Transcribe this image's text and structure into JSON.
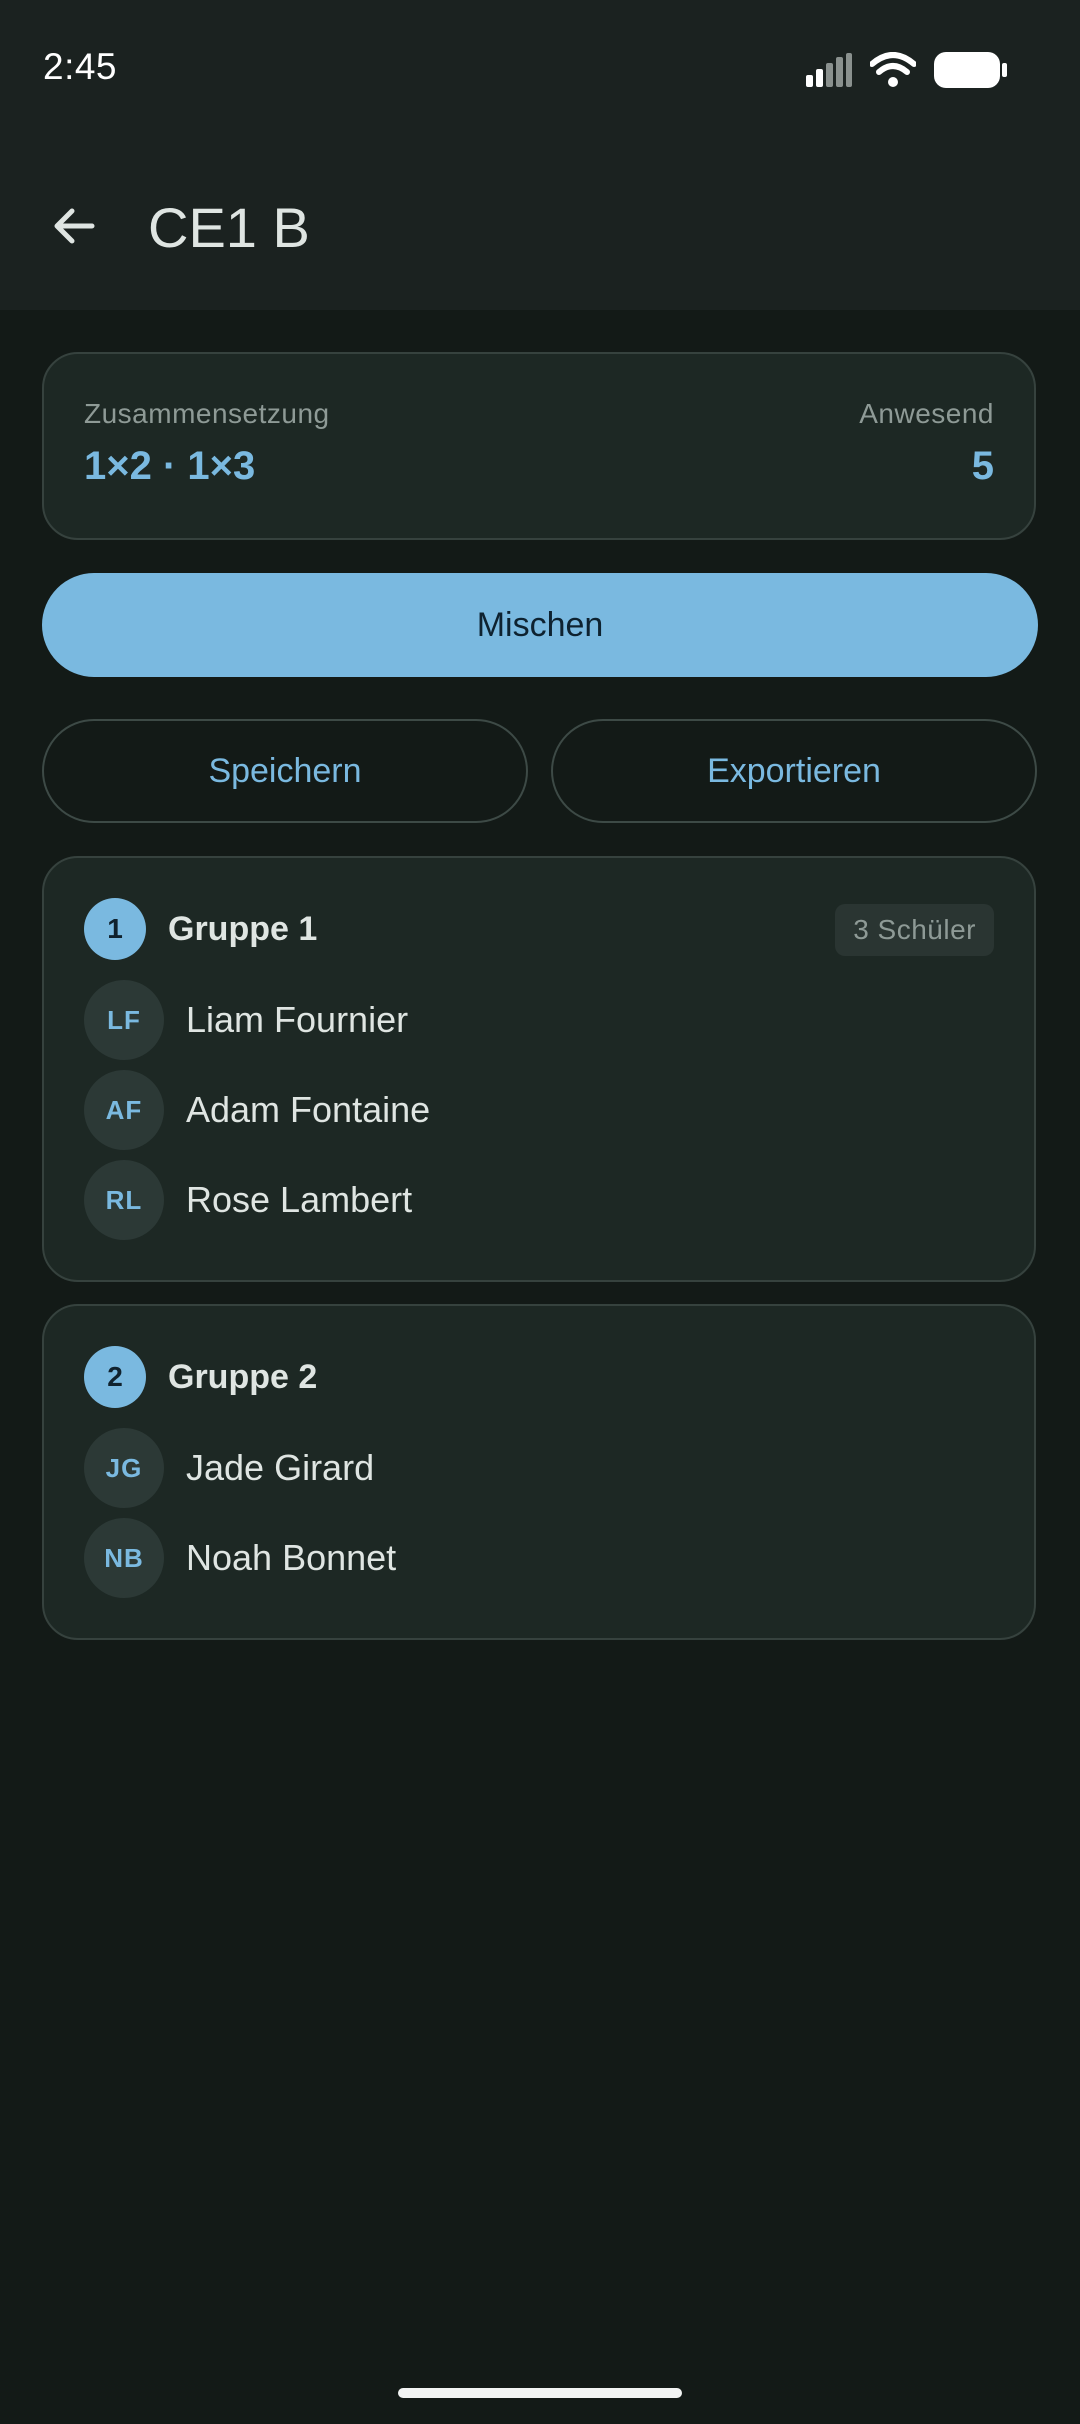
{
  "status_bar": {
    "time": "2:45",
    "icons": [
      "signal-icon",
      "wifi-icon",
      "battery-icon"
    ]
  },
  "header": {
    "back_icon": "arrow-left-icon",
    "title": "CE1 B"
  },
  "summary": {
    "composition_label": "Zusammensetzung",
    "composition_value": "1×2 · 1×3",
    "present_label": "Anwesend",
    "present_value": "5"
  },
  "actions": {
    "shuffle": "Mischen",
    "save": "Speichern",
    "export": "Exportieren"
  },
  "groups": [
    {
      "number": "1",
      "name": "Gruppe 1",
      "count_label": "3 Schüler",
      "members": [
        {
          "initials": "LF",
          "name": "Liam Fournier"
        },
        {
          "initials": "AF",
          "name": "Adam Fontaine"
        },
        {
          "initials": "RL",
          "name": "Rose Lambert"
        }
      ]
    },
    {
      "number": "2",
      "name": "Gruppe 2",
      "members": [
        {
          "initials": "JG",
          "name": "Jade Girard"
        },
        {
          "initials": "NB",
          "name": "Noah Bonnet"
        }
      ]
    }
  ],
  "colors": {
    "accent": "#7ab9e0",
    "background": "#131a17",
    "app_bar": "#1b2220",
    "card": "#1d2824"
  }
}
